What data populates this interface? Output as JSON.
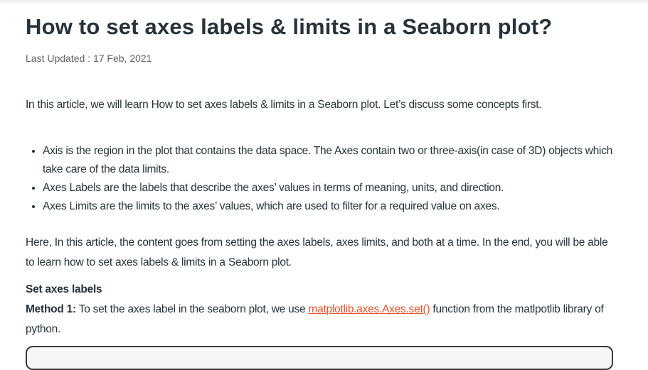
{
  "article": {
    "title": "How to set axes labels & limits in a Seaborn plot?",
    "last_updated": "Last Updated : 17 Feb, 2021",
    "intro": "In this article, we will learn How to set axes labels & limits in a Seaborn plot. Let’s discuss some concepts first.",
    "bullets": [
      "Axis is the region in the plot that contains the data space. The Axes contain two or three-axis(in case of 3D) objects which take care of the data limits.",
      "Axes Labels are the labels that describe the axes’ values in terms of meaning, units, and direction.",
      "Axes Limits are the limits to the axes’ values, which are used to filter for a required value on axes."
    ],
    "overview": "Here, In this article, the content goes from setting the axes labels, axes limits, and both at a time. In the end, you will be able to learn how to set axes labels & limits in a Seaborn plot.",
    "section_heading": "Set axes labels",
    "method_label": "Method 1:",
    "method_text_before": " To set the axes label in the seaborn plot, we use ",
    "method_link": "matplotlib.axes.Axes.set()",
    "method_text_after": " function from the matlpotlib library of python."
  },
  "colors": {
    "text": "#273239",
    "link": "#e5532d"
  }
}
